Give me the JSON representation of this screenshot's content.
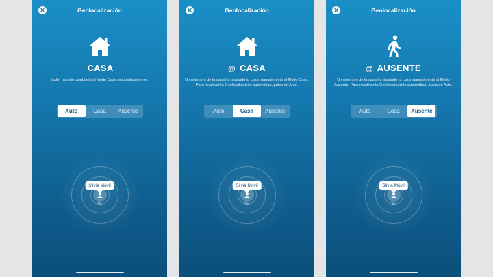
{
  "screens": [
    {
      "title": "Geolocalización",
      "mode_prefix": "",
      "mode": "CASA",
      "description": "tado° ha sido cambiado al Modo Casa automáticamente.",
      "segments": [
        "Auto",
        "Casa",
        "Ausente"
      ],
      "active_segment": "Auto",
      "device_bubble": "Silvia Móvil",
      "me_label": "Yo",
      "icon": "house-icon"
    },
    {
      "title": "Geolocalización",
      "mode_prefix": "@",
      "mode": "CASA",
      "description": "Un miembro de la casa ha ajustado tu casa manualmente al Modo Casa. Para reactivar la Geolocalización automática, pulsa en Auto.",
      "segments": [
        "Auto",
        "Casa",
        "Ausente"
      ],
      "active_segment": "Casa",
      "device_bubble": "Silvia Móvil",
      "me_label": "Yo",
      "icon": "house-icon"
    },
    {
      "title": "Geolocalización",
      "mode_prefix": "@",
      "mode": "AUSENTE",
      "description": "Un miembro de la casa ha ajustado tu casa manualmente al Modo Ausente. Para reactivar la Geolocalización automática, pulsa en Auto.",
      "segments": [
        "Auto",
        "Casa",
        "Ausente"
      ],
      "active_segment": "Ausente",
      "device_bubble": "Silvia Móvil",
      "me_label": "Yo",
      "icon": "walking-person-icon"
    }
  ],
  "colors": {
    "background_top": "#1b8fc7",
    "background_bottom": "#0c4f7b",
    "active_segment_text": "#135c8a"
  }
}
